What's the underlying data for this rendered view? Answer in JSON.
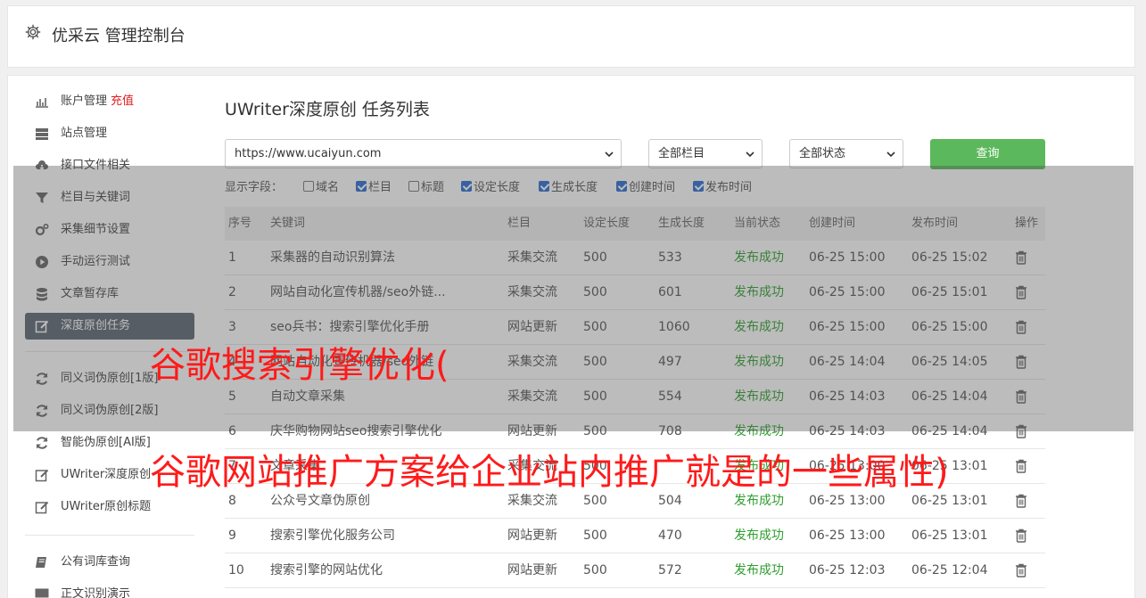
{
  "header": {
    "title": "优采云 管理控制台"
  },
  "sidebar": {
    "items": [
      {
        "label": "账户管理",
        "extra": "充值",
        "icon": "bar-chart-icon"
      },
      {
        "label": "站点管理",
        "icon": "server-icon"
      },
      {
        "label": "接口文件相关",
        "icon": "cloud-download-icon"
      },
      {
        "label": "栏目与关键词",
        "icon": "filter-icon"
      },
      {
        "label": "采集细节设置",
        "icon": "gears-icon"
      },
      {
        "label": "手动运行测试",
        "icon": "play-circle-icon"
      },
      {
        "label": "文章暂存库",
        "icon": "database-icon"
      },
      {
        "label": "深度原创任务",
        "icon": "edit-icon"
      },
      {
        "label": "同义词伪原创[1版]",
        "icon": "refresh-icon"
      },
      {
        "label": "同义词伪原创[2版]",
        "icon": "refresh-icon"
      },
      {
        "label": "智能伪原创[AI版]",
        "icon": "refresh-icon"
      },
      {
        "label": "UWriter深度原创",
        "icon": "edit-icon"
      },
      {
        "label": "UWriter原创标题",
        "icon": "edit-icon"
      },
      {
        "label": "公有词库查询",
        "icon": "book-icon"
      },
      {
        "label": "正文识别演示",
        "icon": "monitor-icon"
      }
    ]
  },
  "page": {
    "title": "UWriter深度原创 任务列表"
  },
  "filters": {
    "site": "https://www.ucaiyun.com",
    "column": "全部栏目",
    "status": "全部状态",
    "query_label": "查询"
  },
  "fields": {
    "label": "显示字段：",
    "options": [
      {
        "label": "域名",
        "checked": false
      },
      {
        "label": "栏目",
        "checked": true
      },
      {
        "label": "标题",
        "checked": false
      },
      {
        "label": "设定长度",
        "checked": true
      },
      {
        "label": "生成长度",
        "checked": true
      },
      {
        "label": "创建时间",
        "checked": true
      },
      {
        "label": "发布时间",
        "checked": true
      }
    ]
  },
  "table": {
    "headers": [
      "序号",
      "关键词",
      "栏目",
      "设定长度",
      "生成长度",
      "当前状态",
      "创建时间",
      "发布时间",
      "操作"
    ],
    "rows": [
      [
        "1",
        "采集器的自动识别算法",
        "采集交流",
        "500",
        "533",
        "发布成功",
        "06-25 15:00",
        "06-25 15:02"
      ],
      [
        "2",
        "网站自动化宣传机器/seo外链...",
        "采集交流",
        "500",
        "601",
        "发布成功",
        "06-25 15:00",
        "06-25 15:01"
      ],
      [
        "3",
        "seo兵书：搜索引擎优化手册",
        "网站更新",
        "500",
        "1060",
        "发布成功",
        "06-25 15:00",
        "06-25 15:00"
      ],
      [
        "4",
        "网站自动化宣传机器/seo外链",
        "采集交流",
        "500",
        "497",
        "发布成功",
        "06-25 14:04",
        "06-25 14:05"
      ],
      [
        "5",
        "自动文章采集",
        "采集交流",
        "500",
        "554",
        "发布成功",
        "06-25 14:03",
        "06-25 14:04"
      ],
      [
        "6",
        "庆华购物网站seo搜索引擎优化",
        "网站更新",
        "500",
        "708",
        "发布成功",
        "06-25 14:03",
        "06-25 14:04"
      ],
      [
        "7",
        "文章采集",
        "采集交流",
        "500",
        "",
        "发布成功",
        "06-25 13:00",
        "06-25 13:01"
      ],
      [
        "8",
        "公众号文章伪原创",
        "采集交流",
        "500",
        "504",
        "发布成功",
        "06-25 13:00",
        "06-25 13:01"
      ],
      [
        "9",
        "搜索引擎优化服务公司",
        "网站更新",
        "500",
        "470",
        "发布成功",
        "06-25 13:00",
        "06-25 13:01"
      ],
      [
        "10",
        "搜索引擎的网站优化",
        "网站更新",
        "500",
        "572",
        "发布成功",
        "06-25 12:03",
        "06-25 12:04"
      ]
    ]
  },
  "overlay": {
    "line1": "谷歌搜索引擎优化(",
    "line2": "谷歌网站推广方案给企业站内推广就是的一些属性)"
  }
}
